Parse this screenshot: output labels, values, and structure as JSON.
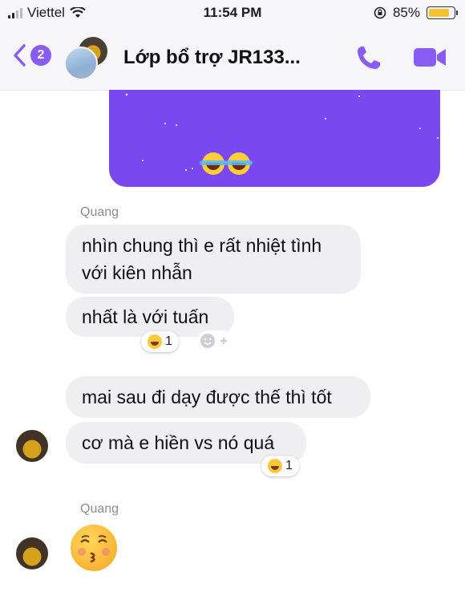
{
  "status_bar": {
    "carrier": "Viettel",
    "time": "11:54 PM",
    "battery_percent": "85%",
    "battery_level": 0.85
  },
  "nav": {
    "unread_count": "2",
    "title": "Lớp bổ trợ JR133..."
  },
  "messages": [
    {
      "sender": "Quang",
      "text": "nhìn chung thì e rất nhiệt tình\nvới kiên nhẫn"
    },
    {
      "text": "nhất là với tuấn",
      "reaction_count": "1"
    },
    {
      "text": "mai sau đi dạy được thế thì tốt"
    },
    {
      "text": "cơ mà e hiền vs nó quá",
      "reaction_count": "1"
    },
    {
      "sender": "Quang",
      "sticker": "kissing-emoji"
    }
  ],
  "colors": {
    "accent": "#8a5cf6",
    "outgoing_bubble": "#7a48f0",
    "incoming_bubble": "#efeff2"
  }
}
